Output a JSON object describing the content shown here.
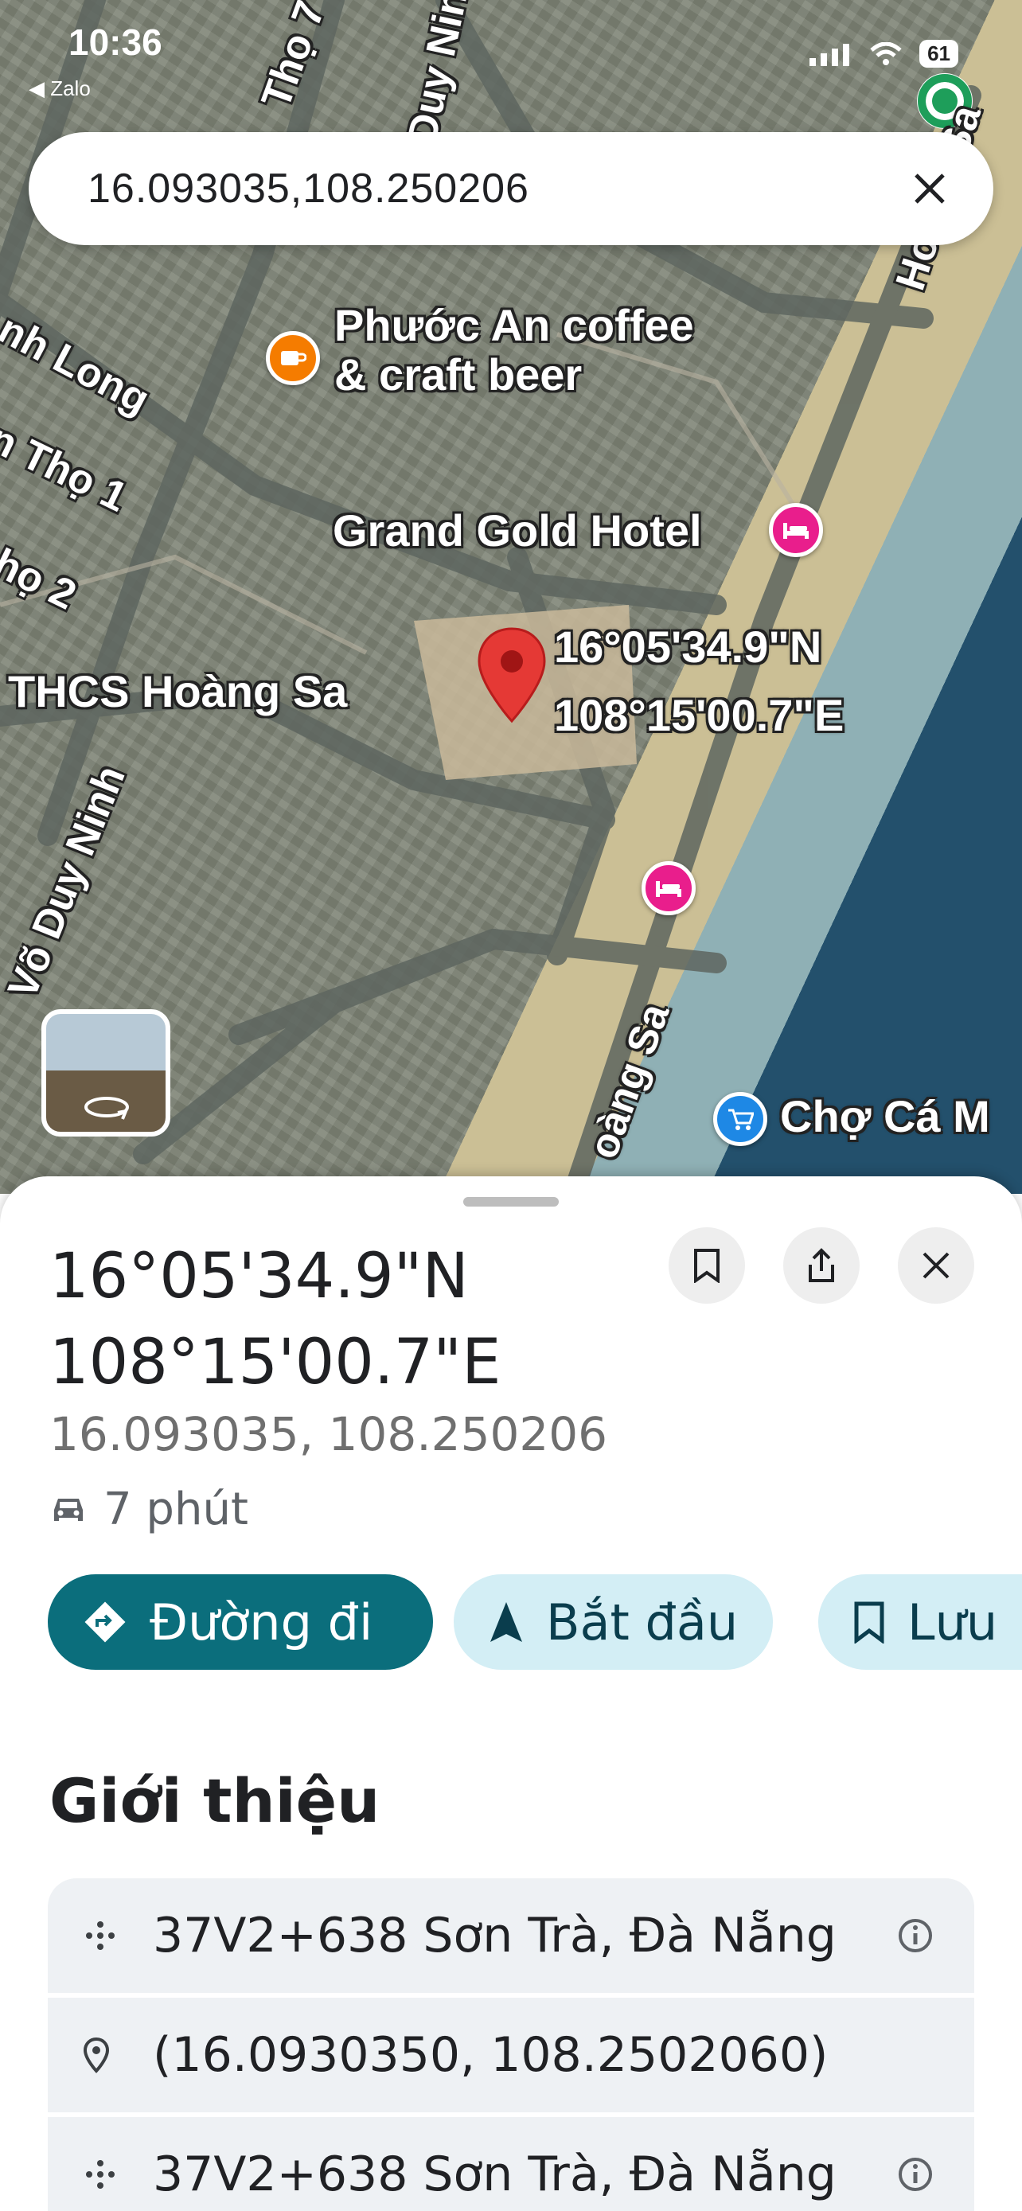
{
  "status": {
    "time": "10:36",
    "back_app": "◀ Zalo",
    "battery": "61"
  },
  "search": {
    "query": "16.093035,108.250206"
  },
  "map_labels": {
    "poi_cafe": "Phước An coffee\n& craft beer",
    "poi_hotel": "Grand Gold Hotel",
    "pin_coords": "16°05'34.9\"N\n108°15'00.7\"E",
    "poi_school": "THCS Hoàng Sa",
    "poi_market": "Chợ Cá M",
    "street_tho7": "Thọ 7",
    "street_duy_ninh_top": "Duy Ninh",
    "street_hoang_sa_top": "Hoàng Sa",
    "street_nh_long": "nh Long",
    "street_tho1": "n Thọ 1",
    "street_tho2": "họ 2",
    "street_vo_duy_ninh": "Võ Duy Ninh",
    "street_hoang_sa_bottom": "oàng Sa"
  },
  "sheet": {
    "title_line1": "16°05'34.9\"N",
    "title_line2": "108°15'00.7\"E",
    "decimal_coords": "16.093035, 108.250206",
    "drive_time": "7 phút",
    "actions": {
      "directions": "Đường đi",
      "start": "Bắt đầu",
      "save": "Lưu"
    },
    "section_title": "Giới thiệu",
    "info_rows": [
      {
        "icon": "plus-code-icon",
        "text": "37V2+638 Sơn Trà, Đà Nẵng"
      },
      {
        "icon": "location-pin-icon",
        "text": "(16.0930350, 108.2502060)"
      },
      {
        "icon": "plus-code-icon",
        "text": "37V2+638 Sơn Trà, Đà Nẵng"
      }
    ]
  },
  "colors": {
    "primary": "#0b6e7c",
    "tonal": "#d3eef5",
    "pin": "#e53935",
    "hotel": "#e91e8c",
    "cafe": "#f57c00",
    "market": "#1e88e5"
  }
}
